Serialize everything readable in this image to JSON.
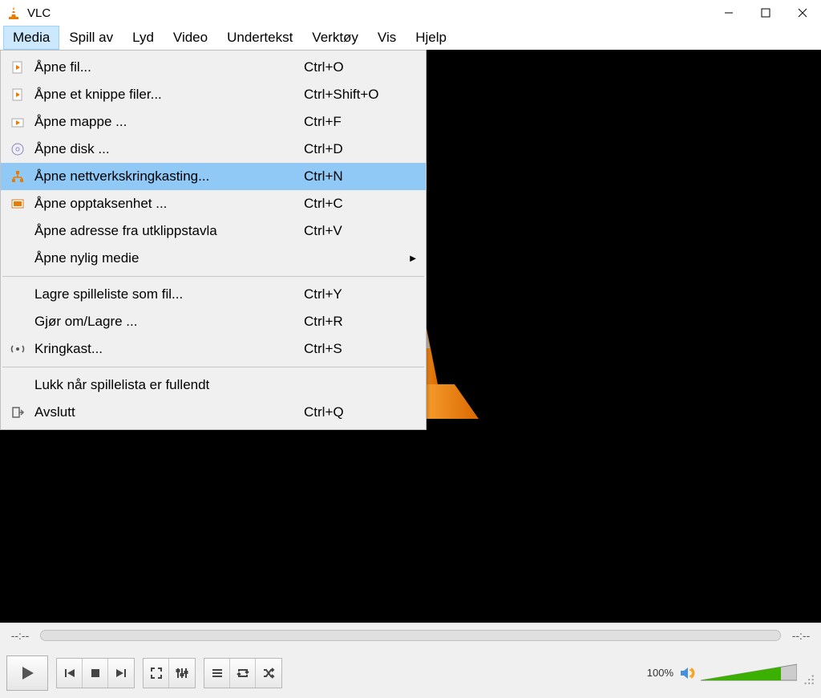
{
  "window": {
    "title": "VLC"
  },
  "menubar": {
    "items": [
      "Media",
      "Spill av",
      "Lyd",
      "Video",
      "Undertekst",
      "Verktøy",
      "Vis",
      "Hjelp"
    ],
    "active_index": 0
  },
  "dropdown": {
    "items": [
      {
        "icon": "file-icon",
        "label": "Åpne fil...",
        "shortcut": "Ctrl+O"
      },
      {
        "icon": "file-play-icon",
        "label": "Åpne et knippe filer...",
        "shortcut": "Ctrl+Shift+O"
      },
      {
        "icon": "folder-play-icon",
        "label": "Åpne mappe ...",
        "shortcut": "Ctrl+F"
      },
      {
        "icon": "disc-icon",
        "label": "Åpne disk ...",
        "shortcut": "Ctrl+D"
      },
      {
        "icon": "network-icon",
        "label": "Åpne nettverkskringkasting...",
        "shortcut": "Ctrl+N",
        "highlight": true
      },
      {
        "icon": "capture-icon",
        "label": "Åpne opptaksenhet ...",
        "shortcut": "Ctrl+C"
      },
      {
        "icon": "",
        "label": "Åpne adresse fra utklippstavla",
        "shortcut": "Ctrl+V"
      },
      {
        "icon": "",
        "label": "Åpne nylig medie",
        "shortcut": "",
        "submenu": true
      },
      {
        "sep": true
      },
      {
        "icon": "",
        "label": "Lagre spilleliste som fil...",
        "shortcut": "Ctrl+Y"
      },
      {
        "icon": "",
        "label": "Gjør om/Lagre ...",
        "shortcut": "Ctrl+R"
      },
      {
        "icon": "stream-icon",
        "label": "Kringkast...",
        "shortcut": "Ctrl+S"
      },
      {
        "sep": true
      },
      {
        "icon": "",
        "label": "Lukk når spillelista er fullendt",
        "shortcut": ""
      },
      {
        "icon": "quit-icon",
        "label": "Avslutt",
        "shortcut": "Ctrl+Q"
      }
    ]
  },
  "player": {
    "time_elapsed": "--:--",
    "time_total": "--:--",
    "volume_label": "100%"
  }
}
